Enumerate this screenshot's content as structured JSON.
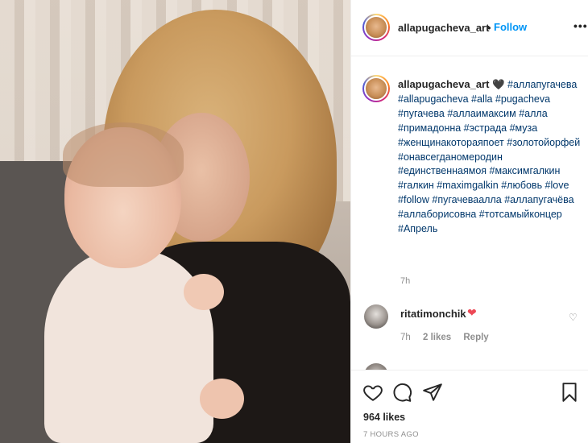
{
  "post": {
    "username": "allapugacheva_art",
    "follow_label": "Follow",
    "separator": "•",
    "more_label": "•••"
  },
  "caption": {
    "username": "allapugacheva_art",
    "heart": "🖤",
    "hashtags": "#аллапугачева #allapugacheva #alla #pugacheva #пугачева #аллаимаксим #алла #примадонна #эстрада #муза #женщинакотораяпоет #золотойорфей #онавсегданомеродин #единственнаямоя #максимгалкин #галкин #maximgalkin #любовь #love #follow  #пугачеваалла #аллапугачёва #аллаборисовна #тотсамыйконцер #Апрель",
    "time": "7h"
  },
  "comments": [
    {
      "username": "ritatimonchik",
      "text": "❤",
      "time": "7h",
      "likes": "2 likes",
      "reply_label": "Reply"
    }
  ],
  "actions": {
    "likes": "964 likes",
    "posted": "7 HOURS AGO"
  },
  "icons": {
    "like": "heart-outline-icon",
    "comment": "comment-bubble-icon",
    "share": "paper-plane-icon",
    "save": "bookmark-icon"
  }
}
